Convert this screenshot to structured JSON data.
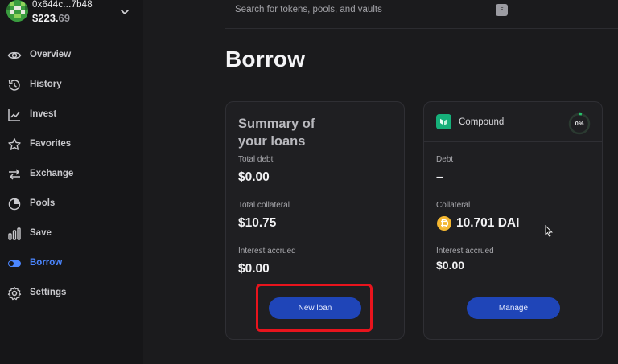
{
  "account": {
    "address": "0x644c...7b48",
    "balance_main": "$223.",
    "balance_cents": "69"
  },
  "sidebar": {
    "items": [
      {
        "label": "Overview",
        "icon": "eye-icon",
        "active": false
      },
      {
        "label": "History",
        "icon": "history-icon",
        "active": false
      },
      {
        "label": "Invest",
        "icon": "chart-line-icon",
        "active": false
      },
      {
        "label": "Favorites",
        "icon": "star-icon",
        "active": false
      },
      {
        "label": "Exchange",
        "icon": "exchange-icon",
        "active": false
      },
      {
        "label": "Pools",
        "icon": "pools-icon",
        "active": false
      },
      {
        "label": "Save",
        "icon": "bar-chart-icon",
        "active": false
      },
      {
        "label": "Borrow",
        "icon": "toggle-icon",
        "active": true
      },
      {
        "label": "Settings",
        "icon": "gear-icon",
        "active": false
      }
    ]
  },
  "search": {
    "placeholder": "Search for tokens, pools, and vaults",
    "shortcut": "F"
  },
  "page": {
    "title": "Borrow"
  },
  "summary": {
    "title": "Summary of your loans",
    "total_debt_label": "Total debt",
    "total_debt_value": "$0.00",
    "total_collateral_label": "Total collateral",
    "total_collateral_value": "$10.75",
    "interest_label": "Interest accrued",
    "interest_value": "$0.00",
    "new_loan_button": "New loan"
  },
  "compound": {
    "name": "Compound",
    "utilization": "0%",
    "debt_label": "Debt",
    "debt_value": "–",
    "collateral_label": "Collateral",
    "collateral_value": "10.701 DAI",
    "interest_label": "Interest accrued",
    "interest_value": "$0.00",
    "manage_button": "Manage"
  },
  "colors": {
    "accent_blue": "#4b86ff",
    "button_blue": "#1f45b8",
    "highlight_red": "#e8141d",
    "compound_green": "#16b07a",
    "dai_gold": "#f4b731"
  }
}
